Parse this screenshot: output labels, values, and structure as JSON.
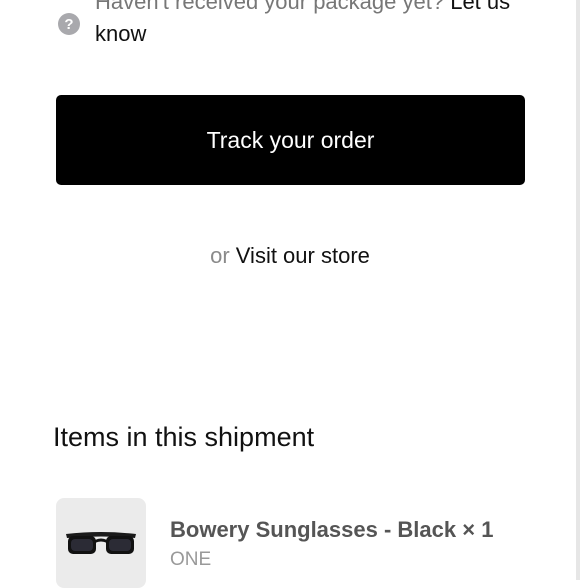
{
  "help": {
    "icon": "question-circle-icon",
    "text": "Haven't received your package yet?",
    "link": "Let us know"
  },
  "track_button": {
    "label": "Track your order"
  },
  "store": {
    "or_text": "or",
    "link": "Visit our store"
  },
  "shipment": {
    "title": "Items in this shipment",
    "items": [
      {
        "name": "Bowery Sunglasses - Black × 1",
        "variant": "ONE",
        "image_icon": "sunglasses-icon"
      }
    ]
  },
  "colors": {
    "button_bg": "#000000",
    "thumb_bg": "#ebebeb",
    "muted_text": "#777777"
  }
}
